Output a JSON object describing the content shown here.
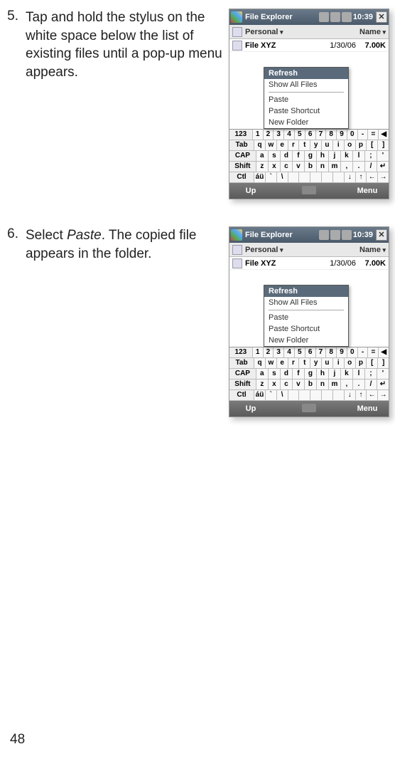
{
  "steps": [
    {
      "num": "5.",
      "text_pre": "Tap and hold the stylus on the white space below the list of existing files until a pop-up menu appears.",
      "text_em": "",
      "text_post": ""
    },
    {
      "num": "6.",
      "text_pre": "Select ",
      "text_em": "Paste",
      "text_post": ". The copied file appears in the folder."
    }
  ],
  "shot": {
    "title": "File Explorer",
    "time": "10:39",
    "close": "✕",
    "folder": "Personal",
    "sort": "Name",
    "file": {
      "name": "File XYZ",
      "date": "1/30/06",
      "size": "7.00K"
    },
    "popup": {
      "header": "Refresh",
      "showall": "Show All Files",
      "paste": "Paste",
      "shortcut": "Paste Shortcut",
      "newfolder": "New Folder"
    },
    "kb": {
      "r1": [
        "123",
        "1",
        "2",
        "3",
        "4",
        "5",
        "6",
        "7",
        "8",
        "9",
        "0",
        "-",
        "=",
        "◀"
      ],
      "r2": [
        "Tab",
        "q",
        "w",
        "e",
        "r",
        "t",
        "y",
        "u",
        "i",
        "o",
        "p",
        "[",
        "]"
      ],
      "r3": [
        "CAP",
        "a",
        "s",
        "d",
        "f",
        "g",
        "h",
        "j",
        "k",
        "l",
        ";",
        "'"
      ],
      "r4": [
        "Shift",
        "z",
        "x",
        "c",
        "v",
        "b",
        "n",
        "m",
        ",",
        ".",
        "/",
        "↵"
      ],
      "r5": [
        "Ctl",
        "áü",
        "`",
        "\\",
        " ",
        " ",
        " ",
        " ",
        " ",
        "↓",
        "↑",
        "←",
        "→"
      ]
    },
    "bottom": {
      "up": "Up",
      "menu": "Menu"
    }
  },
  "page_number": "48"
}
